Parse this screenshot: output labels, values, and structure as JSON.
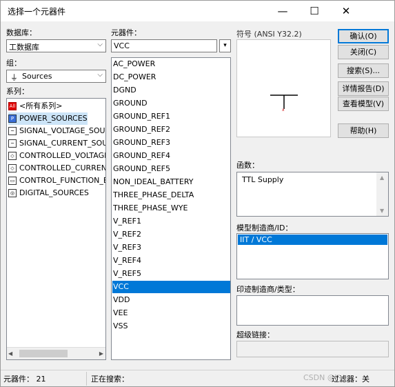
{
  "window": {
    "title": "选择一个元器件"
  },
  "titlebar": {
    "min": "—",
    "max": "☐",
    "close": "✕"
  },
  "left": {
    "db_label": "数据库：",
    "db_value": "工数据库",
    "group_label": "组：",
    "group_value": "Sources",
    "family_label": "系列：",
    "families": [
      {
        "label": "<所有系列>",
        "icon": "all-families-icon"
      },
      {
        "label": "POWER_SOURCES",
        "icon": "power-sources-icon"
      },
      {
        "label": "SIGNAL_VOLTAGE_SOUI",
        "icon": "signal-voltage-icon"
      },
      {
        "label": "SIGNAL_CURRENT_SOU",
        "icon": "signal-current-icon"
      },
      {
        "label": "CONTROLLED_VOLTAGE",
        "icon": "controlled-voltage-icon"
      },
      {
        "label": "CONTROLLED_CURRENT",
        "icon": "controlled-current-icon"
      },
      {
        "label": "CONTROL_FUNCTION_B",
        "icon": "control-function-icon"
      },
      {
        "label": "DIGITAL_SOURCES",
        "icon": "digital-sources-icon"
      }
    ]
  },
  "middle": {
    "comp_label": "元器件：",
    "search_value": "VCC",
    "components": [
      "AC_POWER",
      "DC_POWER",
      "DGND",
      "GROUND",
      "GROUND_REF1",
      "GROUND_REF2",
      "GROUND_REF3",
      "GROUND_REF4",
      "GROUND_REF5",
      "NON_IDEAL_BATTERY",
      "THREE_PHASE_DELTA",
      "THREE_PHASE_WYE",
      "V_REF1",
      "V_REF2",
      "V_REF3",
      "V_REF4",
      "V_REF5",
      "VCC",
      "VDD",
      "VEE",
      "VSS"
    ],
    "selected": "VCC"
  },
  "right": {
    "symbol_label": "符号 (ANSI Y32.2)",
    "function_label": "函数：",
    "function_value": "TTL Supply",
    "model_mfr_label": "模型制造商/ID：",
    "model_mfr_value": "IIT / VCC",
    "footprint_label": "印迹制造商/类型：",
    "hyperlink_label": "超级链接："
  },
  "buttons": {
    "ok": "确认(O)",
    "close": "关闭(C)",
    "search": "搜索(S)...",
    "detail": "详情报告(D)",
    "model": "查看模型(V)",
    "help": "帮助(H)"
  },
  "status": {
    "count": "元器件： 21",
    "searching": "正在搜索：",
    "filter": "过滤器：关",
    "watermark": "CSDN @Y"
  }
}
